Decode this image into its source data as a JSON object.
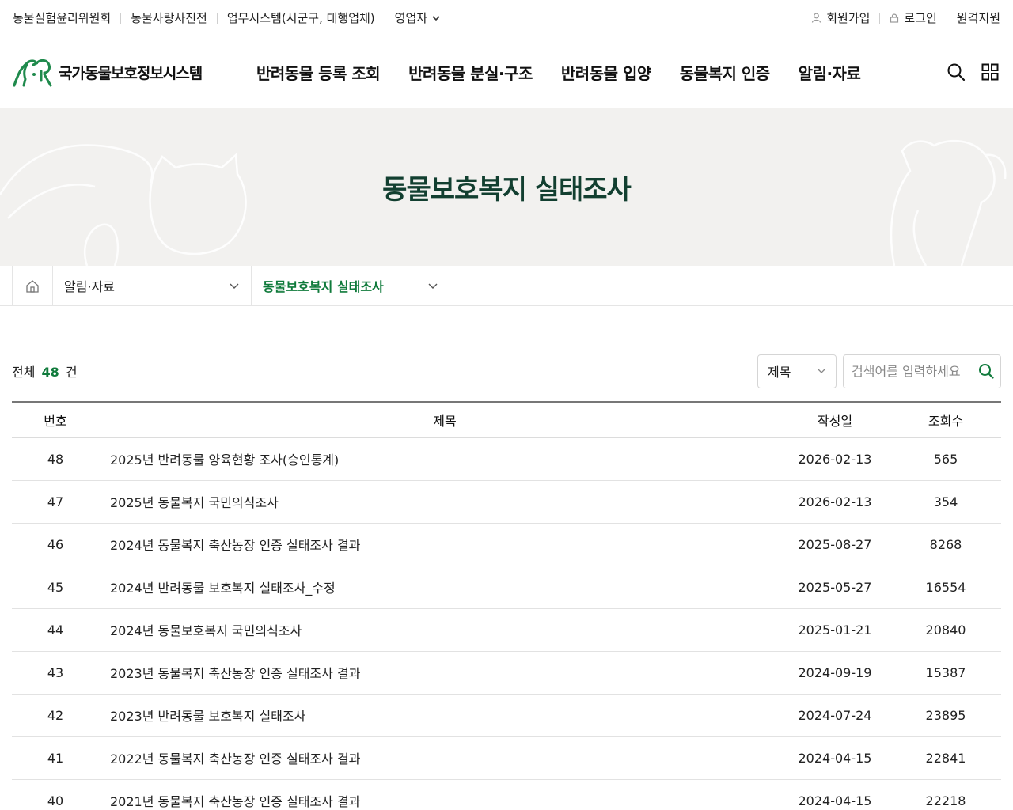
{
  "utility": {
    "left": [
      "동물실험윤리위원회",
      "동물사랑사진전",
      "업무시스템(시군구, 대행업체)",
      "영업자"
    ],
    "signup": "회원가입",
    "login": "로그인",
    "remote": "원격지원"
  },
  "logo": {
    "text": "국가동물보호정보시스템"
  },
  "gnb": [
    "반려동물 등록 조회",
    "반려동물 분실·구조",
    "반려동물 입양",
    "동물복지 인증",
    "알림·자료"
  ],
  "banner": {
    "title": "동물보호복지 실태조사"
  },
  "breadcrumb": {
    "level1": "알림·자료",
    "level2": "동물보호복지 실태조사"
  },
  "list": {
    "total_prefix": "전체",
    "total_count": "48",
    "total_suffix": "건",
    "search_field": "제목",
    "search_placeholder": "검색어를 입력하세요"
  },
  "table": {
    "headers": {
      "num": "번호",
      "title": "제목",
      "date": "작성일",
      "views": "조회수"
    },
    "rows": [
      {
        "num": "48",
        "title": "2025년 반려동물 양육현황 조사(승인통계)",
        "date": "2026-02-13",
        "views": "565"
      },
      {
        "num": "47",
        "title": "2025년 동물복지 국민의식조사",
        "date": "2026-02-13",
        "views": "354"
      },
      {
        "num": "46",
        "title": "2024년 동물복지 축산농장 인증 실태조사 결과",
        "date": "2025-08-27",
        "views": "8268"
      },
      {
        "num": "45",
        "title": "2024년 반려동물 보호복지 실태조사_수정",
        "date": "2025-05-27",
        "views": "16554"
      },
      {
        "num": "44",
        "title": "2024년 동물보호복지 국민의식조사",
        "date": "2025-01-21",
        "views": "20840"
      },
      {
        "num": "43",
        "title": "2023년 동물복지 축산농장 인증 실태조사 결과",
        "date": "2024-09-19",
        "views": "15387"
      },
      {
        "num": "42",
        "title": "2023년 반려동물 보호복지 실태조사",
        "date": "2024-07-24",
        "views": "23895"
      },
      {
        "num": "41",
        "title": "2022년 동물복지 축산농장 인증 실태조사 결과",
        "date": "2024-04-15",
        "views": "22841"
      },
      {
        "num": "40",
        "title": "2021년 동물복지 축산농장 인증 실태조사 결과",
        "date": "2024-04-15",
        "views": "22218"
      }
    ]
  },
  "colors": {
    "accent": "#0f7a3b",
    "banner_bg": "#f2f1ef",
    "banner_title": "#123f30"
  }
}
